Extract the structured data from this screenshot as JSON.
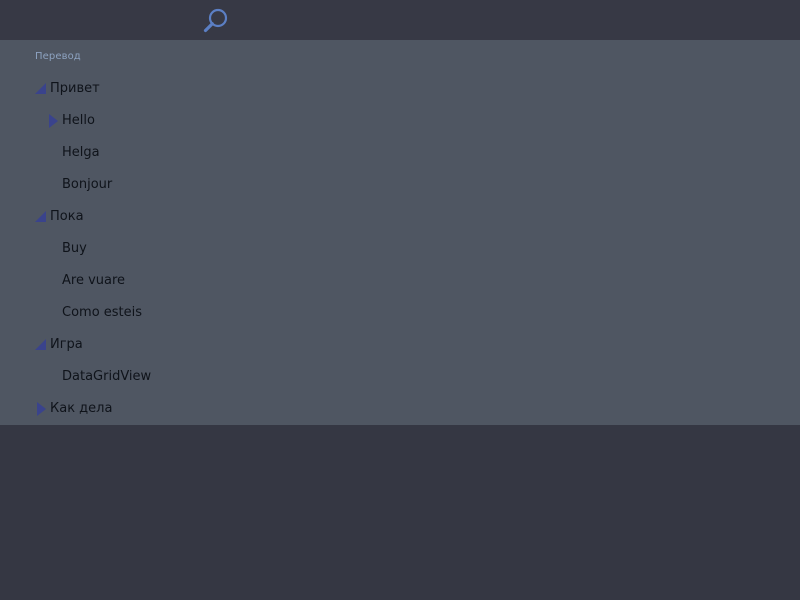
{
  "toolbar": {
    "search_icon": "search-icon"
  },
  "panel": {
    "header": "Перевод"
  },
  "colors": {
    "background": "#353743",
    "panel": "#4f5662",
    "header_text": "#8da2c0",
    "item_text": "#0f131a",
    "toggle": "#3a438c",
    "search_icon": "#5b7fc4"
  },
  "tree": [
    {
      "label": "Привет",
      "level": 0,
      "expander": "expanded"
    },
    {
      "label": "Hello",
      "level": 1,
      "expander": "collapsed"
    },
    {
      "label": "Helga",
      "level": 1,
      "expander": "none"
    },
    {
      "label": "Bonjour",
      "level": 1,
      "expander": "none"
    },
    {
      "label": "Пока",
      "level": 0,
      "expander": "expanded"
    },
    {
      "label": "Buy",
      "level": 1,
      "expander": "none"
    },
    {
      "label": "Are vuare",
      "level": 1,
      "expander": "none"
    },
    {
      "label": "Como esteis",
      "level": 1,
      "expander": "none"
    },
    {
      "label": "Игра",
      "level": 0,
      "expander": "expanded"
    },
    {
      "label": "DataGridView",
      "level": 1,
      "expander": "none"
    },
    {
      "label": "Как дела",
      "level": 0,
      "expander": "collapsed"
    }
  ]
}
